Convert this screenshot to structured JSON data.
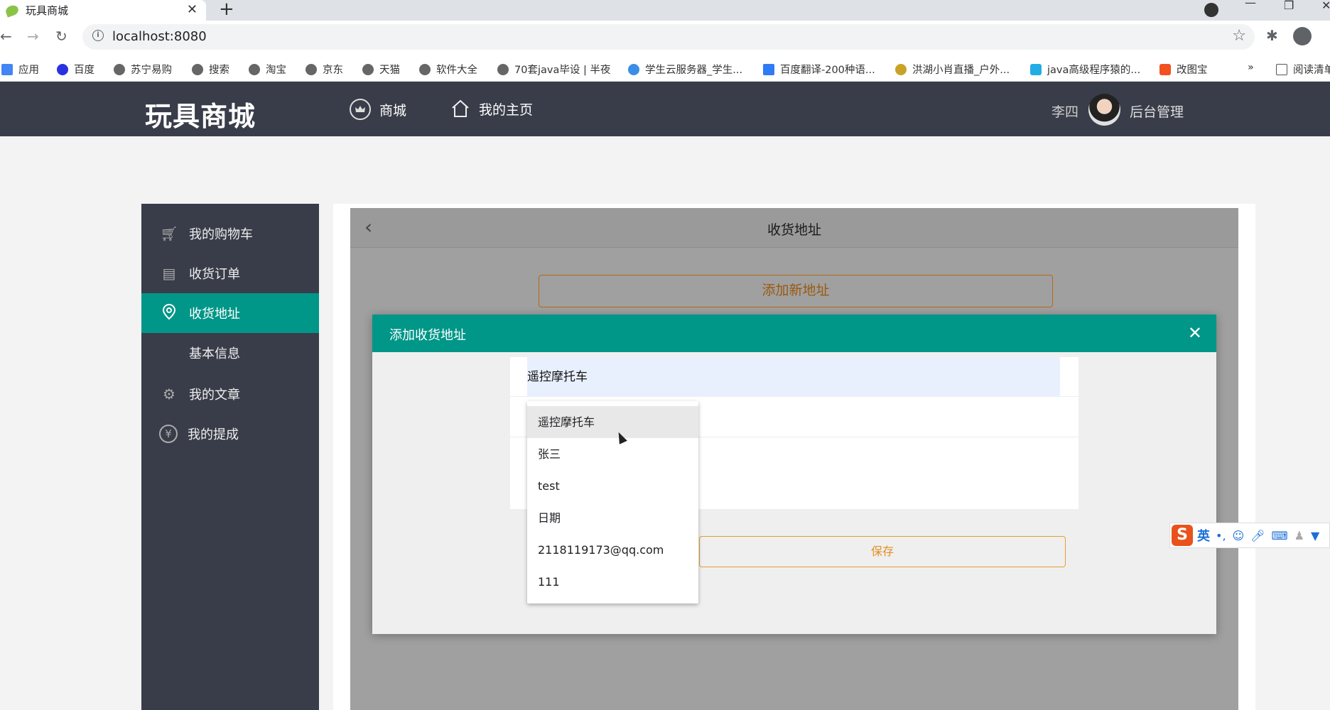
{
  "browser": {
    "tab_title": "玩具商城",
    "url": "localhost:8080",
    "bookmarks": [
      "应用",
      "百度",
      "苏宁易购",
      "搜索",
      "淘宝",
      "京东",
      "天猫",
      "软件大全",
      "70套java毕设 | 半夜",
      "学生云服务器_学生...",
      "百度翻译-200种语...",
      "洪湖小肖直播_户外...",
      "java高级程序猿的...",
      "改图宝",
      "»",
      "阅读清单"
    ]
  },
  "header": {
    "logo": "玩具商城",
    "nav": [
      "商城",
      "我的主页"
    ],
    "user_name": "李四",
    "admin_link": "后台管理"
  },
  "sidebar": {
    "items": [
      {
        "label": "我的购物车",
        "icon": "cart-icon"
      },
      {
        "label": "收货订单",
        "icon": "document-icon"
      },
      {
        "label": "收货地址",
        "icon": "location-pin-icon"
      },
      {
        "label": "基本信息",
        "icon": ""
      },
      {
        "label": "我的文章",
        "icon": "gear-icon"
      },
      {
        "label": "我的提成",
        "icon": "yen-icon"
      }
    ],
    "active_index": 2
  },
  "page": {
    "title": "收货地址",
    "add_new_button": "添加新地址"
  },
  "modal": {
    "title": "添加收货地址",
    "input_value": "遥控摩托车",
    "save_button": "保存"
  },
  "autocomplete": {
    "options": [
      "遥控摩托车",
      "张三",
      "test",
      "日期",
      "2118119173@qq.com",
      "111"
    ]
  },
  "ime": {
    "mode": "英",
    "punct": "•,"
  },
  "colors": {
    "header_bg": "#393d49",
    "accent": "#009688",
    "save_border": "#e0a030"
  }
}
